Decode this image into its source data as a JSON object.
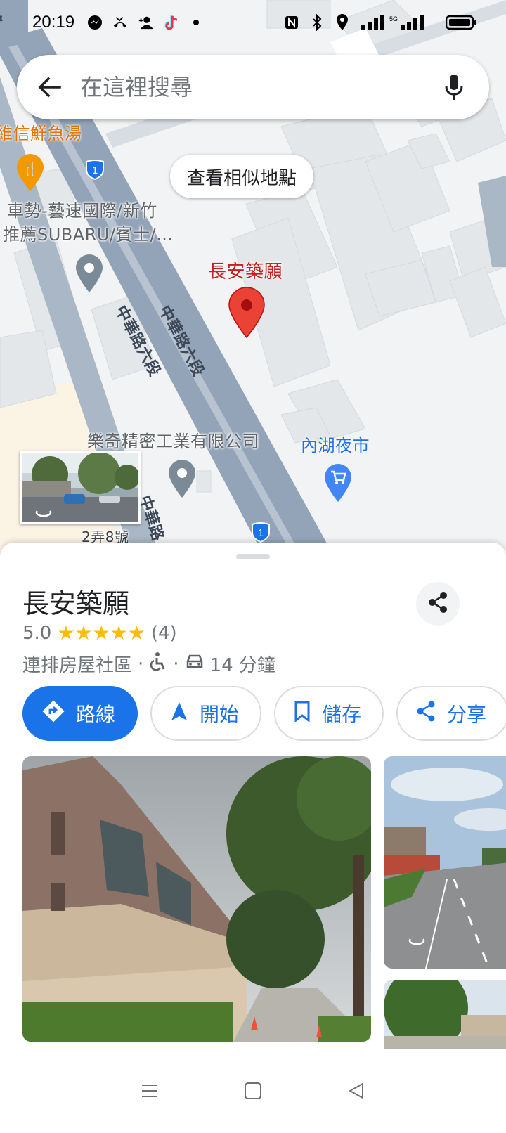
{
  "status_bar": {
    "time": "20:19",
    "left_icons": [
      "messenger-icon",
      "missed-call-icon",
      "add-contact-icon",
      "tiktok-icon",
      "dot-icon"
    ],
    "right_icons": [
      "nfc-icon",
      "bluetooth-icon",
      "location-icon",
      "signal-icon",
      "battery-icon"
    ]
  },
  "search": {
    "placeholder": "在這裡搜尋"
  },
  "map": {
    "similar_places_label": "查看相似地點",
    "labels": {
      "restaurant": "維信鮮魚湯",
      "dealer_line1": "車勢-藝速國際/新竹",
      "dealer_line2": "推薦SUBARU/賓士/...",
      "selected_place": "長安築願",
      "road_1": "中華路六段",
      "road_2": "中華路六段",
      "road_3": "中華路",
      "company": "樂奇精密工業有限公司",
      "night_market": "內湖夜市",
      "address": "2弄8號",
      "road_top": "路",
      "route_shield": "1"
    }
  },
  "place": {
    "title": "長安築願",
    "rating": "5.0",
    "stars": "★★★★★",
    "review_count": "(4)",
    "category": "連排房屋社區",
    "separator": "·",
    "drive_time": "14 分鐘"
  },
  "actions": {
    "directions": "路線",
    "start": "開始",
    "save": "儲存",
    "share": "分享"
  },
  "colors": {
    "accent": "#1a73e8",
    "pin_red": "#ea4335",
    "star": "#fbbc04",
    "road": "#93a4b8"
  }
}
